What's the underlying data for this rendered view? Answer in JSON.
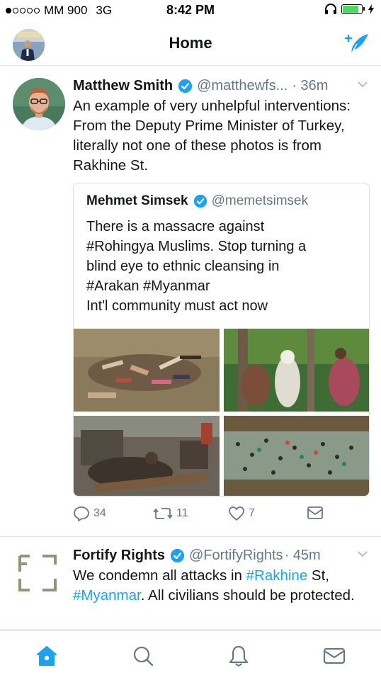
{
  "status_bar": {
    "carrier": "MM 900",
    "network": "3G",
    "time": "8:42 PM",
    "signal_bars": 1,
    "signal_max": 5,
    "battery_level": 0.85
  },
  "nav": {
    "title": "Home"
  },
  "colors": {
    "accent": "#1da1f2",
    "text": "#14171a",
    "secondary": "#657786",
    "divider": "#e1e8ed"
  },
  "tweets": [
    {
      "name": "Matthew Smith",
      "handle": "@matthewfs...",
      "time": "· 36m",
      "verified": true,
      "text": "An example of very unhelpful interventions: From the Deputy Prime Minister of Turkey, literally not one of these photos is from Rakhine St.",
      "quote": {
        "name": "Mehmet Simsek",
        "handle": "@memetsimsek",
        "verified": true,
        "lines": [
          "There is a massacre against",
          "#Rohingya Muslims. Stop turning a",
          "blind eye to ethnic cleansing in",
          "#Arakan #Myanmar",
          "Int'l community must act now"
        ]
      },
      "actions": {
        "replies": "34",
        "retweets": "11",
        "likes": "7"
      }
    },
    {
      "name": "Fortify Rights",
      "handle": "@FortifyRights",
      "time": "· 45m",
      "verified": true,
      "text_parts": {
        "p1": "We condemn all attacks in ",
        "link1": "#Rakhine",
        "p2": " St,",
        "link2": "#Myanmar",
        "p3": ". All civilians should be protected."
      }
    }
  ],
  "tabs": [
    "home-icon",
    "search-icon",
    "notifications-icon",
    "messages-icon"
  ]
}
